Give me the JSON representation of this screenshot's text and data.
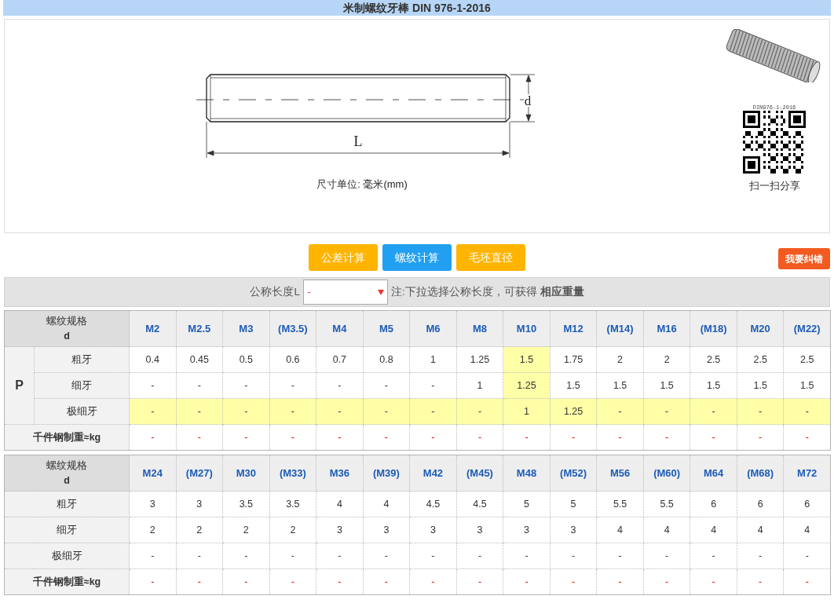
{
  "title": "米制螺纹牙棒 DIN 976-1-2016",
  "figure": {
    "dim_d": "d",
    "dim_l": "L",
    "unit_label": "尺寸单位: ",
    "unit_value": "毫米(mm)"
  },
  "qr": {
    "code_text": "DIN976-1-2016",
    "caption": "扫一扫分享"
  },
  "buttons": [
    {
      "label": "公差计算",
      "color": "#ffb400"
    },
    {
      "label": "螺纹计算",
      "color": "#21a0f2"
    },
    {
      "label": "毛坯直径",
      "color": "#ffb400"
    }
  ],
  "report_button": {
    "label": "我要纠错"
  },
  "length_filter": {
    "label": "公称长度L",
    "value": "-",
    "note": "注:下拉选择公称长度，可获得 **相应重量**"
  },
  "tables": [
    {
      "header_label": "螺纹规格",
      "header_sub": "d",
      "pitch_label": "P",
      "sizes": [
        {
          "label": "M2",
          "highlighted": false
        },
        {
          "label": "M2.5",
          "highlighted": false
        },
        {
          "label": "M3",
          "highlighted": false
        },
        {
          "label": "(M3.5)",
          "highlighted": false
        },
        {
          "label": "M4",
          "highlighted": false
        },
        {
          "label": "M5",
          "highlighted": false
        },
        {
          "label": "M6",
          "highlighted": false
        },
        {
          "label": "M8",
          "highlighted": false
        },
        {
          "label": "M10",
          "highlighted": true
        },
        {
          "label": "M12",
          "highlighted": false
        },
        {
          "label": "(M14)",
          "highlighted": false
        },
        {
          "label": "M16",
          "highlighted": false
        },
        {
          "label": "(M18)",
          "highlighted": false
        },
        {
          "label": "M20",
          "highlighted": false
        },
        {
          "label": "(M22)",
          "highlighted": false
        }
      ],
      "rows": [
        {
          "label": "粗牙",
          "kind": "pitch",
          "highlighted": false,
          "values": [
            "0.4",
            "0.45",
            "0.5",
            "0.6",
            "0.7",
            "0.8",
            "1",
            "1.25",
            "1.5",
            "1.75",
            "2",
            "2",
            "2.5",
            "2.5",
            "2.5"
          ]
        },
        {
          "label": "细牙",
          "kind": "pitch",
          "highlighted": false,
          "values": [
            "-",
            "-",
            "-",
            "-",
            "-",
            "-",
            "-",
            "1",
            "1.25",
            "1.5",
            "1.5",
            "1.5",
            "1.5",
            "1.5",
            "1.5"
          ]
        },
        {
          "label": "极细牙",
          "kind": "pitch",
          "highlighted": true,
          "values": [
            "-",
            "-",
            "-",
            "-",
            "-",
            "-",
            "-",
            "-",
            "1",
            "1.25",
            "-",
            "-",
            "-",
            "-",
            "-"
          ]
        },
        {
          "label": "千件钢制重≈kg",
          "kind": "weight",
          "values": [
            "-",
            "-",
            "-",
            "-",
            "-",
            "-",
            "-",
            "-",
            "-",
            "-",
            "-",
            "-",
            "-",
            "-",
            "-"
          ]
        }
      ]
    },
    {
      "header_label": "螺纹规格",
      "header_sub": "d",
      "sizes": [
        {
          "label": "M24",
          "highlighted": false
        },
        {
          "label": "(M27)",
          "highlighted": false
        },
        {
          "label": "M30",
          "highlighted": false
        },
        {
          "label": "(M33)",
          "highlighted": false
        },
        {
          "label": "M36",
          "highlighted": false
        },
        {
          "label": "(M39)",
          "highlighted": false
        },
        {
          "label": "M42",
          "highlighted": false
        },
        {
          "label": "(M45)",
          "highlighted": false
        },
        {
          "label": "M48",
          "highlighted": false
        },
        {
          "label": "(M52)",
          "highlighted": false
        },
        {
          "label": "M56",
          "highlighted": false
        },
        {
          "label": "(M60)",
          "highlighted": false
        },
        {
          "label": "M64",
          "highlighted": false
        },
        {
          "label": "(M68)",
          "highlighted": false
        },
        {
          "label": "M72",
          "highlighted": false
        }
      ],
      "rows": [
        {
          "label": "粗牙",
          "kind": "pitch",
          "highlighted": false,
          "values": [
            "3",
            "3",
            "3.5",
            "3.5",
            "4",
            "4",
            "4.5",
            "4.5",
            "5",
            "5",
            "5.5",
            "5.5",
            "6",
            "6",
            "6"
          ]
        },
        {
          "label": "细牙",
          "kind": "pitch",
          "highlighted": false,
          "values": [
            "2",
            "2",
            "2",
            "2",
            "3",
            "3",
            "3",
            "3",
            "3",
            "3",
            "4",
            "4",
            "4",
            "4",
            "4"
          ]
        },
        {
          "label": "极细牙",
          "kind": "pitch",
          "highlighted": false,
          "values": [
            "-",
            "-",
            "-",
            "-",
            "-",
            "-",
            "-",
            "-",
            "-",
            "-",
            "-",
            "-",
            "-",
            "-",
            "-"
          ]
        },
        {
          "label": "千件钢制重≈kg",
          "kind": "weight",
          "values": [
            "-",
            "-",
            "-",
            "-",
            "-",
            "-",
            "-",
            "-",
            "-",
            "-",
            "-",
            "-",
            "-",
            "-",
            "-"
          ]
        }
      ]
    }
  ]
}
